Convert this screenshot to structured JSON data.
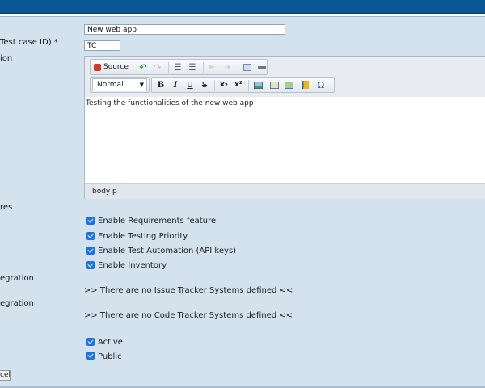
{
  "form": {
    "labels": {
      "name_cut": "",
      "prefix_cut": "Test case ID) *",
      "description_cut": "ion",
      "features_cut": "res",
      "issue_cut": "egration",
      "code_cut": "egration"
    },
    "name_value": "New web app",
    "prefix_value": "TC"
  },
  "editor": {
    "source_label": "Source",
    "format_label": "Normal",
    "content_text": "Testing the functionalities of the new web app",
    "path": [
      "body",
      "p"
    ],
    "toolbar_icons": [
      "source-icon",
      "undo-icon",
      "redo-icon",
      "numbered-list-icon",
      "bulleted-list-icon",
      "outdent-icon",
      "indent-icon",
      "table-icon",
      "horizontal-rule-icon",
      "bold-icon",
      "italic-icon",
      "underline-icon",
      "strike-icon",
      "subscript-icon",
      "superscript-icon",
      "image-icon",
      "link-icon",
      "unlink-icon",
      "anchor-icon",
      "special-char-icon"
    ],
    "glyphs": {
      "bold": "B",
      "italic": "I",
      "underline": "U",
      "strike": "S",
      "sub": "x₂",
      "sup": "x²",
      "omega": "Ω"
    }
  },
  "features": [
    {
      "label": "Enable Requirements feature",
      "checked": true
    },
    {
      "label": "Enable Testing Priority",
      "checked": true
    },
    {
      "label": "Enable Test Automation (API keys)",
      "checked": true
    },
    {
      "label": "Enable Inventory",
      "checked": true
    }
  ],
  "issue_tracker_msg": ">> There are no Issue Tracker Systems defined <<",
  "code_tracker_msg": ">> There are no Code Tracker Systems defined <<",
  "status": [
    {
      "label": "Active",
      "checked": true
    },
    {
      "label": "Public",
      "checked": true
    }
  ],
  "cancel_label": "cel",
  "colors": {
    "header": "#0a5796",
    "background": "#d4e2ee",
    "checkbox": "#1a73e8"
  }
}
